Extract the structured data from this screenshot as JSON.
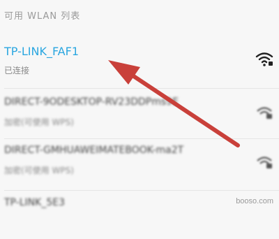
{
  "header": {
    "title": "可用 WLAN 列表"
  },
  "networks": [
    {
      "ssid": "TP-LINK_FAF1",
      "status": "已连接",
      "icon": "wifi-connected-icon",
      "state": "connected"
    },
    {
      "ssid": "DIRECT-9ODESKTOP-RV23DDPms9E",
      "status": "加密(可使用 WPS)",
      "icon": "wifi-locked-icon",
      "state": "secured"
    },
    {
      "ssid": "DIRECT-GMHUAWEIMATEBOOK-ma2T",
      "status": "加密(可使用 WPS)",
      "icon": "wifi-locked-icon",
      "state": "secured"
    },
    {
      "ssid": "TP-LINK_5E3",
      "status": "",
      "icon": "wifi-locked-icon",
      "state": "secured"
    }
  ],
  "colors": {
    "connected": "#2aa6e0",
    "arrow": "#c9403a"
  },
  "watermark": "booso.com"
}
